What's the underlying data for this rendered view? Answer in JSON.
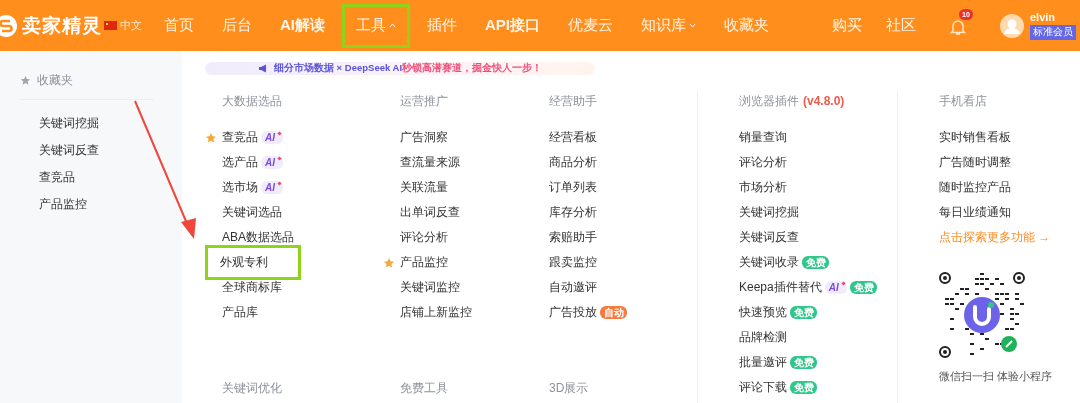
{
  "header": {
    "brand": "卖家精灵",
    "language": "中文",
    "nav": [
      {
        "label": "首页",
        "dropdown": false,
        "highlighted": false
      },
      {
        "label": "后台",
        "dropdown": false,
        "highlighted": false
      },
      {
        "label": "AI解读",
        "dropdown": false,
        "highlighted": false
      },
      {
        "label": "工具",
        "dropdown": true,
        "highlighted": true
      },
      {
        "label": "插件",
        "dropdown": false,
        "highlighted": false
      },
      {
        "label": "API接口",
        "dropdown": false,
        "highlighted": false
      },
      {
        "label": "优麦云",
        "dropdown": false,
        "highlighted": false
      },
      {
        "label": "知识库",
        "dropdown": true,
        "highlighted": false
      },
      {
        "label": "收藏夹",
        "dropdown": false,
        "highlighted": false
      }
    ],
    "right_links": [
      "购买",
      "社区"
    ],
    "notifications": "10",
    "user": {
      "name": "elvin",
      "plan": "标准会员"
    }
  },
  "sidebar": {
    "title": "收藏夹",
    "items": [
      "关键词挖掘",
      "关键词反查",
      "查竞品",
      "产品监控"
    ]
  },
  "banner": {
    "lead": "细分市场数据 × DeepSeek AI",
    "rest": "秒锁高潜赛道，掘金快人一步！"
  },
  "columns": [
    {
      "sections": [
        {
          "title": "大数据选品",
          "items": [
            {
              "label": "查竞品",
              "starred": true,
              "highlighted": false,
              "badges": [
                {
                  "kind": "ai",
                  "text": "AI"
                }
              ]
            },
            {
              "label": "选产品",
              "starred": false,
              "highlighted": false,
              "badges": [
                {
                  "kind": "ai",
                  "text": "AI"
                }
              ]
            },
            {
              "label": "选市场",
              "starred": false,
              "highlighted": false,
              "badges": [
                {
                  "kind": "ai",
                  "text": "AI"
                }
              ]
            },
            {
              "label": "关键词选品",
              "starred": false,
              "highlighted": false
            },
            {
              "label": "ABA数据选品",
              "starred": false,
              "highlighted": false
            },
            {
              "label": "外观专利",
              "starred": false,
              "highlighted": true
            },
            {
              "label": "全球商标库",
              "starred": false,
              "highlighted": false
            },
            {
              "label": "产品库",
              "starred": false,
              "highlighted": false
            }
          ]
        },
        {
          "title": "关键词优化"
        }
      ]
    },
    {
      "sections": [
        {
          "title": "运营推广",
          "items": [
            {
              "label": "广告洞察",
              "starred": false,
              "highlighted": false
            },
            {
              "label": "查流量来源",
              "starred": false,
              "highlighted": false
            },
            {
              "label": "关联流量",
              "starred": false,
              "highlighted": false
            },
            {
              "label": "出单词反查",
              "starred": false,
              "highlighted": false
            },
            {
              "label": "评论分析",
              "starred": false,
              "highlighted": false
            },
            {
              "label": "产品监控",
              "starred": true,
              "highlighted": false
            },
            {
              "label": "关键词监控",
              "starred": false,
              "highlighted": false
            },
            {
              "label": "店铺上新监控",
              "starred": false,
              "highlighted": false
            }
          ]
        },
        {
          "title": "免费工具"
        }
      ]
    },
    {
      "sections": [
        {
          "title": "经营助手",
          "items": [
            {
              "label": "经营看板",
              "starred": false,
              "highlighted": false
            },
            {
              "label": "商品分析",
              "starred": false,
              "highlighted": false
            },
            {
              "label": "订单列表",
              "starred": false,
              "highlighted": false
            },
            {
              "label": "库存分析",
              "starred": false,
              "highlighted": false
            },
            {
              "label": "索赔助手",
              "starred": false,
              "highlighted": false
            },
            {
              "label": "跟卖监控",
              "starred": false,
              "highlighted": false
            },
            {
              "label": "自动邀评",
              "starred": false,
              "highlighted": false
            },
            {
              "label": "广告投放",
              "starred": false,
              "highlighted": false,
              "badges": [
                {
                  "kind": "auto",
                  "text": "自动"
                }
              ]
            }
          ]
        },
        {
          "title": "3D展示"
        }
      ]
    },
    {
      "divider": true,
      "sections": [
        {
          "title": "浏览器插件",
          "version": "(v4.8.0)",
          "items": [
            {
              "label": "销量查询",
              "starred": false,
              "highlighted": false
            },
            {
              "label": "评论分析",
              "starred": false,
              "highlighted": false
            },
            {
              "label": "市场分析",
              "starred": false,
              "highlighted": false
            },
            {
              "label": "关键词挖掘",
              "starred": false,
              "highlighted": false
            },
            {
              "label": "关键词反查",
              "starred": false,
              "highlighted": false
            },
            {
              "label": "关键词收录",
              "starred": false,
              "highlighted": false,
              "badges": [
                {
                  "kind": "free",
                  "text": "免费"
                }
              ]
            },
            {
              "label": "Keepa插件替代",
              "starred": false,
              "highlighted": false,
              "badges": [
                {
                  "kind": "ai",
                  "text": "AI"
                },
                {
                  "kind": "free",
                  "text": "免费"
                }
              ]
            },
            {
              "label": "快速预览",
              "starred": false,
              "highlighted": false,
              "badges": [
                {
                  "kind": "free",
                  "text": "免费"
                }
              ]
            },
            {
              "label": "品牌检测",
              "starred": false,
              "highlighted": false
            },
            {
              "label": "批量邀评",
              "starred": false,
              "highlighted": false,
              "badges": [
                {
                  "kind": "free",
                  "text": "免费"
                }
              ]
            },
            {
              "label": "评论下载",
              "starred": false,
              "highlighted": false,
              "badges": [
                {
                  "kind": "free",
                  "text": "免费"
                }
              ]
            }
          ]
        }
      ]
    },
    {
      "divider": true,
      "sections": [
        {
          "title": "手机看店",
          "items": [
            {
              "label": "实时销售看板",
              "starred": false,
              "highlighted": false
            },
            {
              "label": "广告随时调整",
              "starred": false,
              "highlighted": false
            },
            {
              "label": "随时监控产品",
              "starred": false,
              "highlighted": false
            },
            {
              "label": "每日业绩通知",
              "starred": false,
              "highlighted": false
            },
            {
              "label": "点击探索更多功能 →",
              "kind": "link",
              "starred": false,
              "highlighted": false
            }
          ]
        }
      ],
      "qr_caption": "微信扫一扫 体验小程序"
    }
  ]
}
